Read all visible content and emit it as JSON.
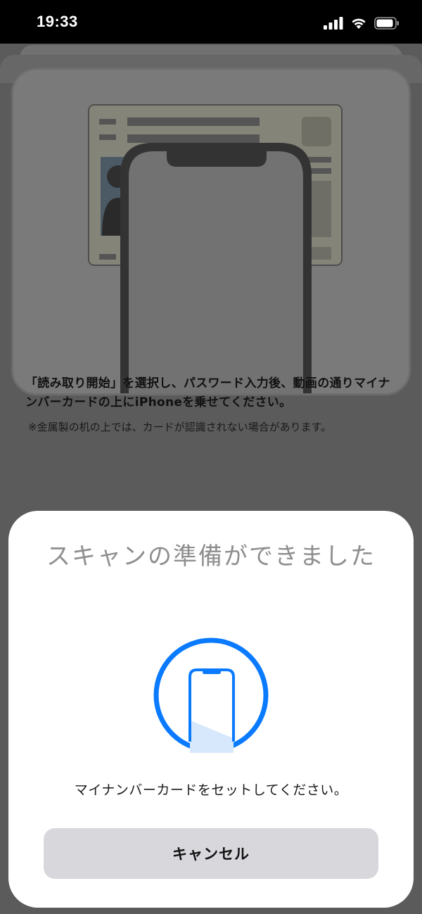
{
  "status_bar": {
    "time": "19:33"
  },
  "instructions": {
    "main": "「読み取り開始」を選択し、パスワード入力後、動画の通りマイナンバーカードの上にiPhoneを乗せてください。",
    "note": "※金属製の机の上では、カードが認識されない場合があります。"
  },
  "scan_sheet": {
    "title": "スキャンの準備ができました",
    "message": "マイナンバーカードをセットしてください。",
    "cancel_label": "キャンセル"
  },
  "colors": {
    "accent": "#0a7aff",
    "sheet_bg": "#ffffff",
    "dim_bg": "#5b5b5b"
  }
}
